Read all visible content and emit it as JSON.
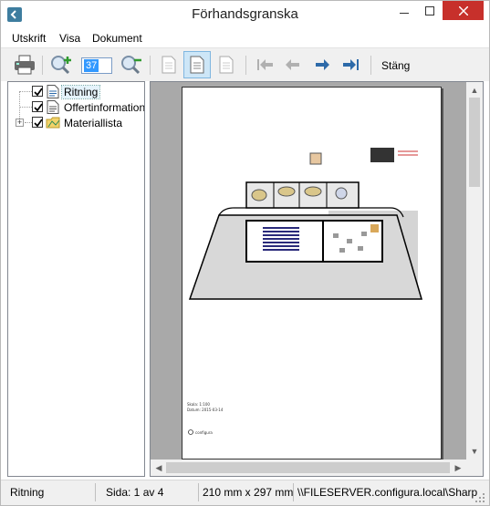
{
  "window": {
    "title": "Förhandsgranska"
  },
  "menu": {
    "items": [
      "Utskrift",
      "Visa",
      "Dokument"
    ]
  },
  "toolbar": {
    "zoom_value": "37",
    "close_label": "Stäng"
  },
  "tree": {
    "items": [
      {
        "label": "Ritning",
        "checked": true,
        "icon": "document-icon",
        "selected": true
      },
      {
        "label": "Offertinformation",
        "checked": true,
        "icon": "document-icon",
        "selected": false
      },
      {
        "label": "Materiallista",
        "checked": true,
        "icon": "folder-icon",
        "selected": false,
        "expandable": true
      }
    ]
  },
  "page": {
    "footer_lines": [
      "Skala: 1:100",
      "Datum: 2015-03-14"
    ],
    "logo_text": "configura"
  },
  "status": {
    "section": "Ritning",
    "page": "Sida: 1 av 4",
    "paper": "210 mm x 297 mm",
    "printer": "\\\\FILESERVER.configura.local\\Sharp"
  },
  "colors": {
    "accent": "#3399ff",
    "close_button": "#c7302b",
    "nav_arrow": "#2d6aa9"
  }
}
